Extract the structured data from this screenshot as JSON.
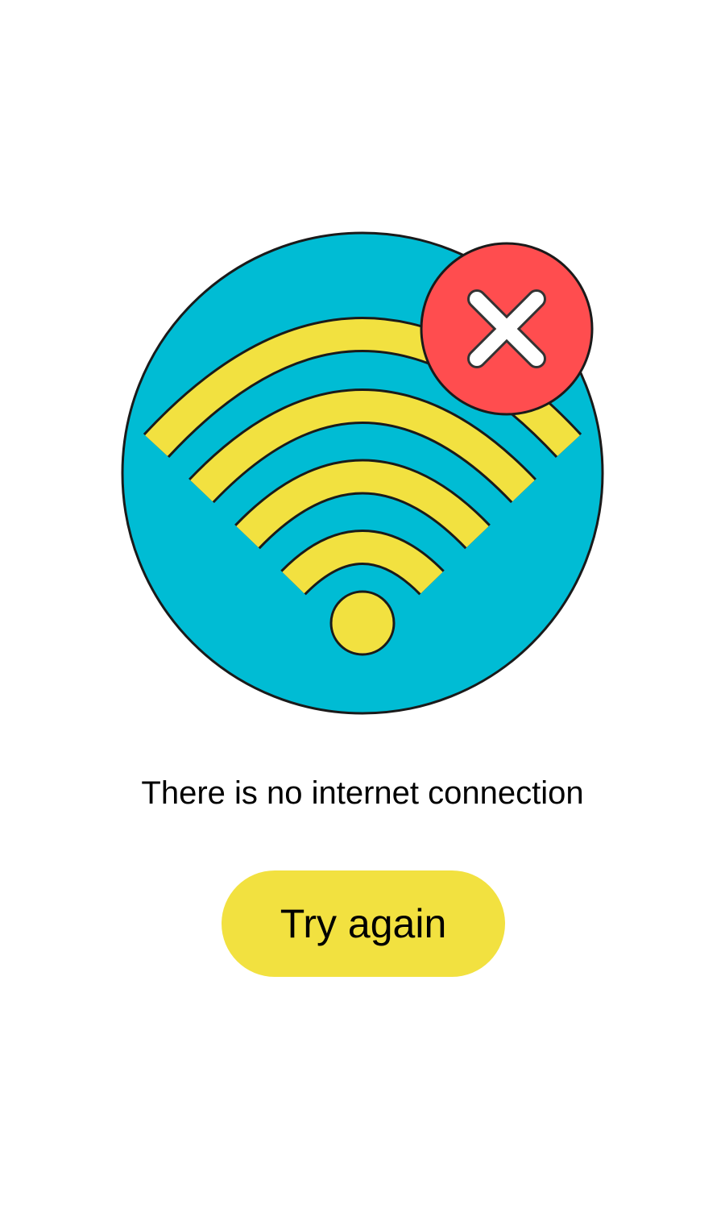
{
  "message": "There is no internet connection",
  "retry_button": {
    "label": "Try again"
  },
  "icons": {
    "illustration": "wifi-off-illustration",
    "wifi": "wifi-icon",
    "error_badge": "close-icon"
  },
  "colors": {
    "background": "#ffffff",
    "circle": "#00bcd4",
    "wifi": "#f2e140",
    "error_badge": "#ff4d4f",
    "error_cross": "#ffffff",
    "outline": "#1a1a1a",
    "button": "#f2e140",
    "text": "#000000"
  }
}
